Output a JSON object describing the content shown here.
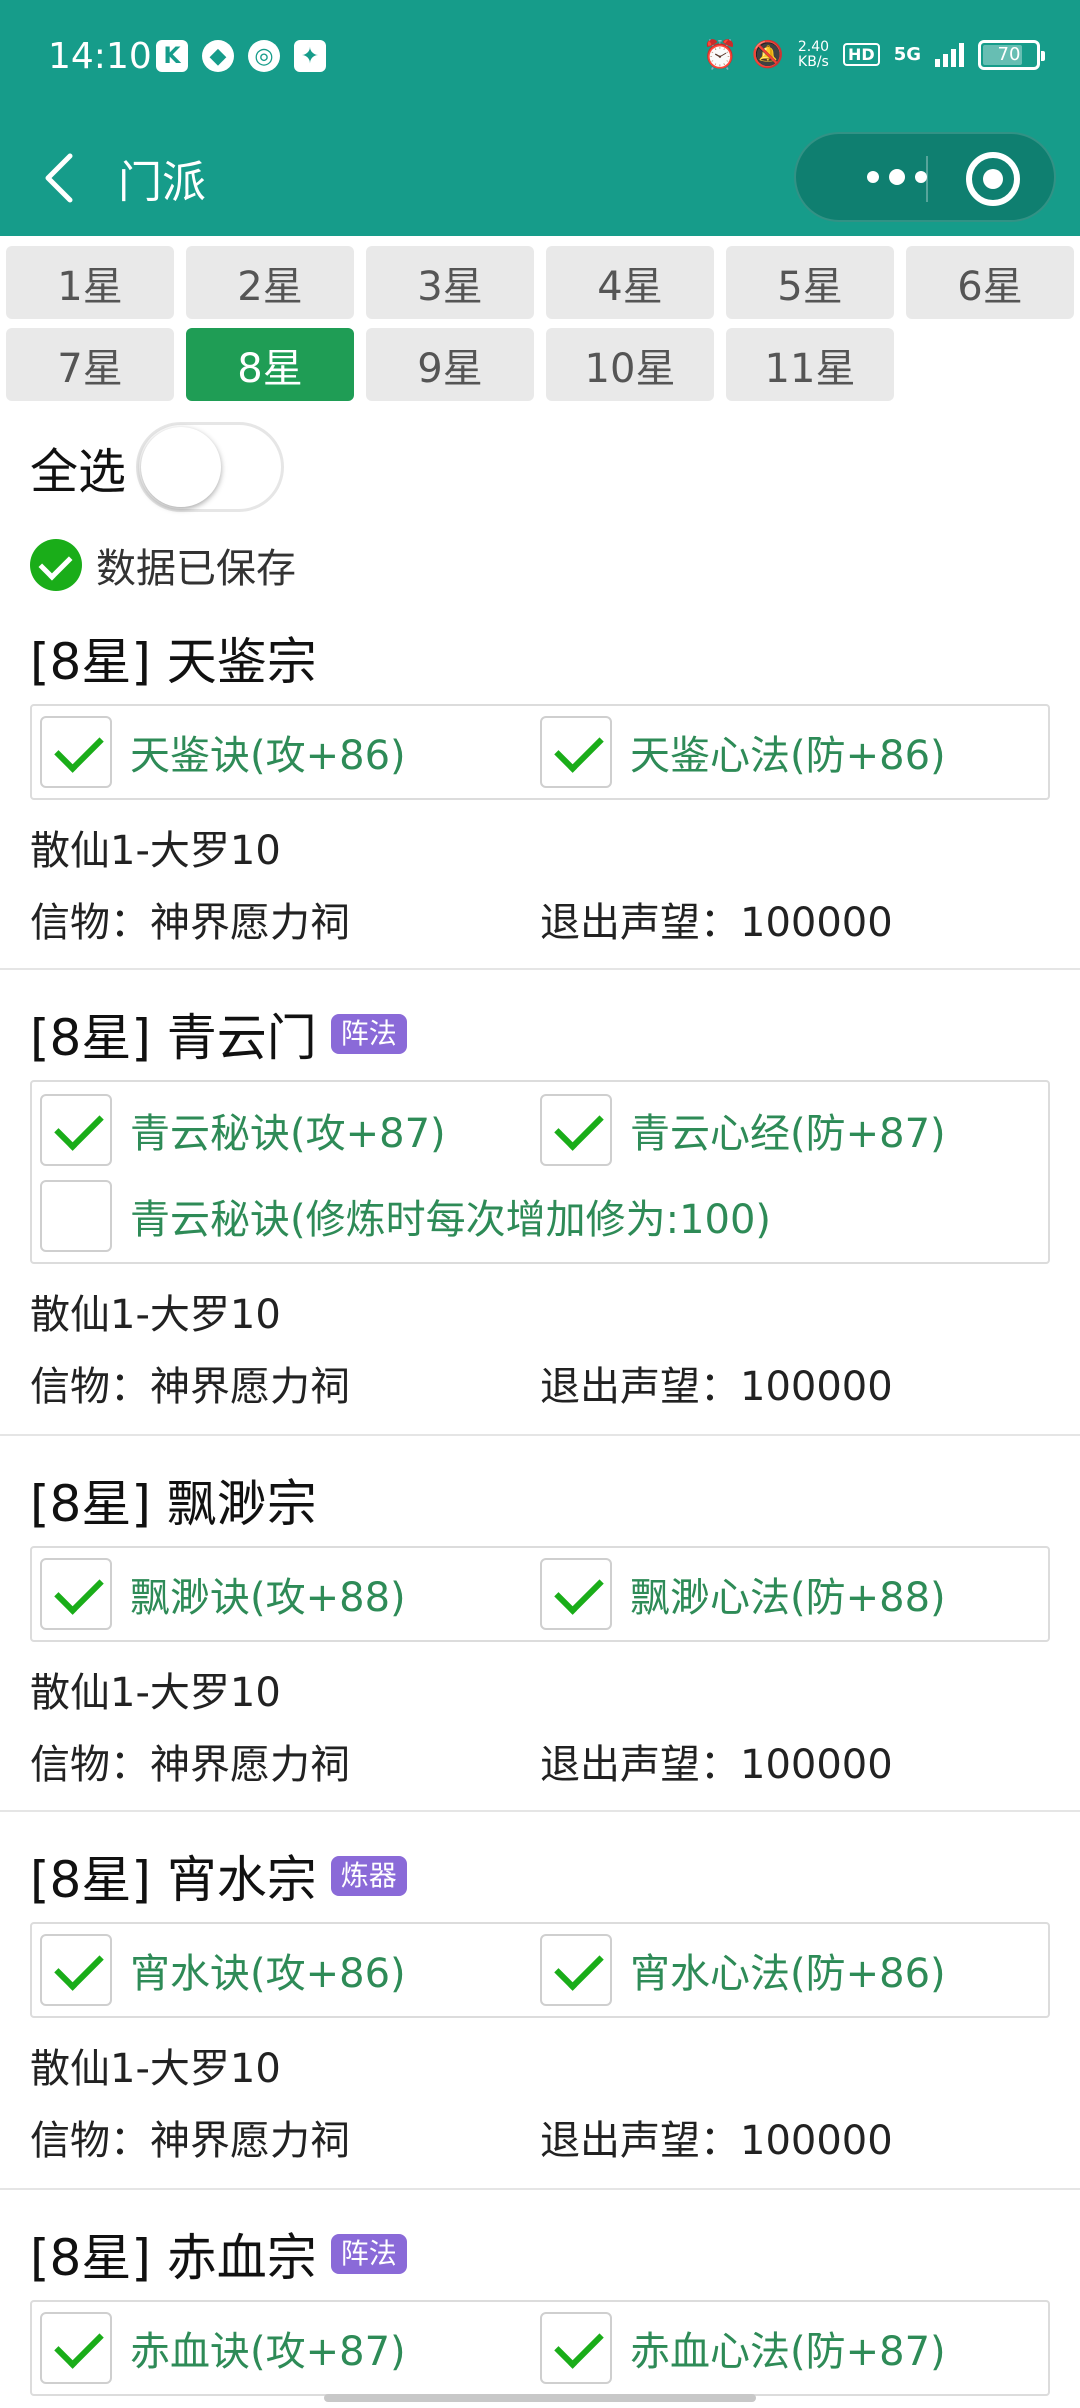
{
  "status_bar": {
    "time": "14:10",
    "left_icons": [
      "K",
      "qq-icon",
      "netease-icon",
      "game-icon"
    ],
    "speed_value": "2.40",
    "speed_unit": "KB/s",
    "hd": "HD",
    "network": "5G",
    "battery": "70"
  },
  "nav": {
    "title": "门派"
  },
  "stars": [
    "1星",
    "2星",
    "3星",
    "4星",
    "5星",
    "6星",
    "7星",
    "8星",
    "9星",
    "10星",
    "11星"
  ],
  "active_star": "8星",
  "select_all": {
    "label": "全选",
    "on": false
  },
  "saved": {
    "text": "数据已保存"
  },
  "sects": [
    {
      "title": "[8星] 天鉴宗",
      "badge": "",
      "skills": [
        {
          "label": "天鉴诀(攻+86)",
          "checked": true
        },
        {
          "label": "天鉴心法(防+86)",
          "checked": true
        }
      ],
      "range": "散仙1-大罗10",
      "relic": "信物：神界愿力祠",
      "reputation": "退出声望：100000"
    },
    {
      "title": "[8星] 青云门",
      "badge": "阵法",
      "skills": [
        {
          "label": "青云秘诀(攻+87)",
          "checked": true
        },
        {
          "label": "青云心经(防+87)",
          "checked": true
        },
        {
          "label": "青云秘诀(修炼时每次增加修为:100)",
          "checked": false
        }
      ],
      "range": "散仙1-大罗10",
      "relic": "信物：神界愿力祠",
      "reputation": "退出声望：100000"
    },
    {
      "title": "[8星] 飘渺宗",
      "badge": "",
      "skills": [
        {
          "label": "飘渺诀(攻+88)",
          "checked": true
        },
        {
          "label": "飘渺心法(防+88)",
          "checked": true
        }
      ],
      "range": "散仙1-大罗10",
      "relic": "信物：神界愿力祠",
      "reputation": "退出声望：100000"
    },
    {
      "title": "[8星] 宵水宗",
      "badge": "炼器",
      "skills": [
        {
          "label": "宵水诀(攻+86)",
          "checked": true
        },
        {
          "label": "宵水心法(防+86)",
          "checked": true
        }
      ],
      "range": "散仙1-大罗10",
      "relic": "信物：神界愿力祠",
      "reputation": "退出声望：100000"
    },
    {
      "title": "[8星] 赤血宗",
      "badge": "阵法",
      "skills": [
        {
          "label": "赤血诀(攻+87)",
          "checked": true
        },
        {
          "label": "赤血心法(防+87)",
          "checked": true
        }
      ],
      "range": "",
      "relic": "",
      "reputation": ""
    }
  ],
  "colors": {
    "header": "#169c8a",
    "active": "#1f9d55",
    "skill_text": "#2e8b57",
    "badge": "#8a6ad8",
    "check": "#1aad19"
  }
}
